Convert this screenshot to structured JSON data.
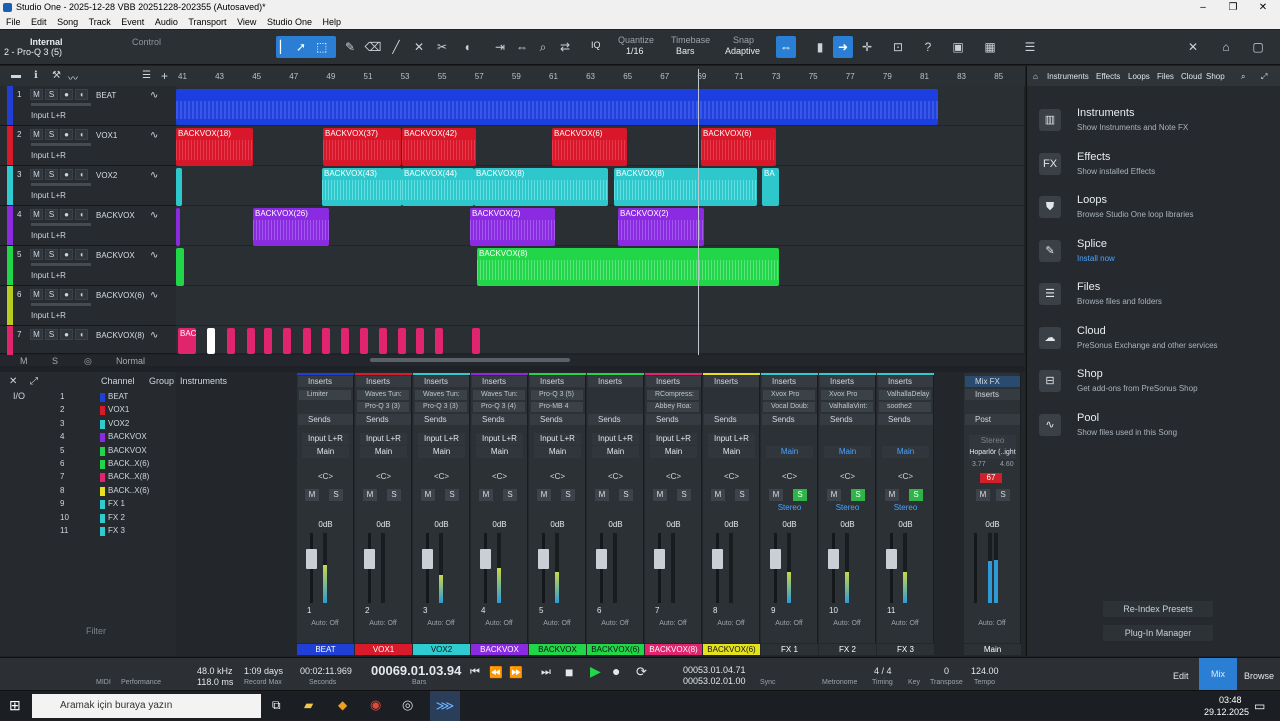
{
  "window": {
    "title": "Studio One - 2025-12-28 VBB 20251228-202355 (Autosaved)*"
  },
  "menu": [
    "File",
    "Edit",
    "Song",
    "Track",
    "Event",
    "Audio",
    "Transport",
    "View",
    "Studio One",
    "Help"
  ],
  "toolbar": {
    "sync_source": "Internal",
    "sync_alt": "Control",
    "focus": "2 - Pro-Q 3 (5)",
    "quantize_label": "Quantize",
    "quantize": "1/16",
    "timebase_label": "Timebase",
    "timebase": "Bars",
    "snap_label": "Snap",
    "snap": "Adaptive",
    "iq": "IQ"
  },
  "ruler": [
    "41",
    "43",
    "45",
    "47",
    "49",
    "51",
    "53",
    "55",
    "57",
    "59",
    "61",
    "63",
    "65",
    "67",
    "69",
    "71",
    "73",
    "75",
    "77",
    "79",
    "81",
    "83",
    "85"
  ],
  "tracks": [
    {
      "num": "1",
      "name": "BEAT",
      "input": "Input L+R",
      "color": "#1f3fd6"
    },
    {
      "num": "2",
      "name": "VOX1",
      "input": "Input L+R",
      "color": "#d91a2a"
    },
    {
      "num": "3",
      "name": "VOX2",
      "input": "Input L+R",
      "color": "#2ecbd0"
    },
    {
      "num": "4",
      "name": "BACKVOX",
      "input": "Input L+R",
      "color": "#8a2be2"
    },
    {
      "num": "5",
      "name": "BACKVOX",
      "input": "Input L+R",
      "color": "#22d64a"
    },
    {
      "num": "6",
      "name": "BACKVOX(6)",
      "input": "Input L+R",
      "color": "#b7cc1e"
    },
    {
      "num": "7",
      "name": "BACKVOX(8)",
      "input": "",
      "color": "#e0246e"
    }
  ],
  "clips": {
    "vox1": [
      "BACKVOX(18)",
      "BACKVOX(37)",
      "BACKVOX(42)",
      "BACKVOX(6)",
      "BACKVOX(6)"
    ],
    "vox2": [
      "BACKVOX(43)",
      "BACKVOX(44)",
      "BACKVOX(8)",
      "BACKVOX(8)",
      "BA"
    ],
    "backvox": [
      "BACKVOX(26)",
      "BACKVOX(2)",
      "BACKVOX(2)"
    ],
    "backvox5": [
      "BACKVOX(8)"
    ],
    "backvox8": [
      "BAC"
    ]
  },
  "timeline_footer": {
    "mode": "Normal"
  },
  "mixer_list": {
    "headers": [
      "Channel",
      "Group",
      "Instruments"
    ],
    "channels": [
      {
        "n": "1",
        "name": "BEAT"
      },
      {
        "n": "2",
        "name": "VOX1"
      },
      {
        "n": "3",
        "name": "VOX2"
      },
      {
        "n": "4",
        "name": "BACKVOX"
      },
      {
        "n": "5",
        "name": "BACKVOX"
      },
      {
        "n": "6",
        "name": "BACK..X(6)"
      },
      {
        "n": "7",
        "name": "BACK..X(8)"
      },
      {
        "n": "8",
        "name": "BACK..X(6)"
      },
      {
        "n": "9",
        "name": "FX 1"
      },
      {
        "n": "10",
        "name": "FX 2"
      },
      {
        "n": "11",
        "name": "FX 3"
      }
    ],
    "filter": "Filter",
    "io": "I/O"
  },
  "strips": [
    {
      "idx": "1",
      "label": "BEAT",
      "color": "#1f3fd6",
      "plugins": [
        "Limiter",
        ""
      ],
      "input": "Input L+R",
      "out": "Main",
      "db": "0dB",
      "meter": 0.55,
      "solo": false
    },
    {
      "idx": "2",
      "label": "VOX1",
      "color": "#d91a2a",
      "plugins": [
        "Waves Tun:",
        "Pro-Q 3 (3)"
      ],
      "input": "Input L+R",
      "out": "Main",
      "db": "0dB",
      "meter": 0.0,
      "solo": false
    },
    {
      "idx": "3",
      "label": "VOX2",
      "color": "#2ecbd0",
      "plugins": [
        "Waves Tun:",
        "Pro-Q 3 (3)"
      ],
      "input": "Input L+R",
      "out": "Main",
      "db": "0dB",
      "meter": 0.4,
      "solo": false
    },
    {
      "idx": "4",
      "label": "BACKVOX",
      "color": "#8a2be2",
      "plugins": [
        "Waves Tun:",
        "Pro-Q 3 (4)"
      ],
      "input": "Input L+R",
      "out": "Main",
      "db": "0dB",
      "meter": 0.5,
      "solo": false
    },
    {
      "idx": "5",
      "label": "BACKVOX",
      "color": "#22d64a",
      "plugins": [
        "Pro-Q 3 (5)",
        "Pro-MB 4"
      ],
      "input": "Input L+R",
      "out": "Main",
      "db": "0dB",
      "meter": 0.45,
      "solo": false
    },
    {
      "idx": "6",
      "label": "BACKVOX(6)",
      "color": "#22d64a",
      "plugins": [
        "",
        ""
      ],
      "input": "Input L+R",
      "out": "Main",
      "db": "0dB",
      "meter": 0.0,
      "solo": false
    },
    {
      "idx": "7",
      "label": "BACKVOX(8)",
      "color": "#e0246e",
      "plugins": [
        "RCompress:",
        "Abbey Roa:"
      ],
      "input": "Input L+R",
      "out": "Main",
      "db": "0dB",
      "meter": 0.0,
      "solo": false
    },
    {
      "idx": "8",
      "label": "BACKVOX(6)",
      "color": "#e4e21e",
      "plugins": [
        "",
        ""
      ],
      "input": "Input L+R",
      "out": "Main",
      "db": "0dB",
      "meter": 0.0,
      "solo": false
    },
    {
      "idx": "9",
      "label": "FX 1",
      "color": "#2ecbd0",
      "plugins": [
        "Xvox Pro",
        "Vocal Doub:"
      ],
      "input": "",
      "out": "Main",
      "db": "0dB",
      "meter": 0.45,
      "solo": true
    },
    {
      "idx": "10",
      "label": "FX 2",
      "color": "#2ecbd0",
      "plugins": [
        "Xvox Pro",
        "ValhallaVint:"
      ],
      "input": "",
      "out": "Main",
      "db": "0dB",
      "meter": 0.45,
      "solo": true
    },
    {
      "idx": "11",
      "label": "FX 3",
      "color": "#2ecbd0",
      "plugins": [
        "ValhallaDelay",
        "soothe2"
      ],
      "input": "",
      "out": "Main",
      "db": "0dB",
      "meter": 0.45,
      "solo": true
    }
  ],
  "strip_text": {
    "inserts": "Inserts",
    "sends": "Sends",
    "pan": "<C>",
    "auto": "Auto: Off",
    "stereo": "Stereo"
  },
  "main": {
    "label": "Main",
    "mixfx": "Mix FX",
    "post": "Post",
    "stereo": "Stereo",
    "out": "Hoparlör (..ight",
    "peak": "67",
    "l": "3.77",
    "r": "4.60",
    "db": "0dB"
  },
  "browser": {
    "tabs": [
      "Instruments",
      "Effects",
      "Loops",
      "Files",
      "Cloud",
      "Shop"
    ],
    "items": [
      {
        "icon": "piano-icon",
        "title": "Instruments",
        "desc": "Show Instruments and Note FX"
      },
      {
        "icon": "fx-icon",
        "title": "Effects",
        "desc": "Show installed Effects"
      },
      {
        "icon": "shield-icon",
        "title": "Loops",
        "desc": "Browse Studio One loop libraries"
      },
      {
        "icon": "splice-icon",
        "title": "Splice",
        "desc": "Install now"
      },
      {
        "icon": "list-icon",
        "title": "Files",
        "desc": "Browse files and folders"
      },
      {
        "icon": "cloud-icon",
        "title": "Cloud",
        "desc": "PreSonus Exchange and other services"
      },
      {
        "icon": "bag-icon",
        "title": "Shop",
        "desc": "Get add-ons from PreSonus Shop"
      },
      {
        "icon": "wave-icon",
        "title": "Pool",
        "desc": "Show files used in this Song"
      }
    ],
    "reindex": "Re-Index Presets",
    "plugin_manager": "Plug-In Manager"
  },
  "transport": {
    "midi": "MIDI",
    "performance": "Performance",
    "rate": "48.0 kHz",
    "latency": "118.0 ms",
    "rec_days": "1:09 days",
    "rec_label": "Record Max",
    "seconds": "00:02:11.969",
    "seconds_label": "Seconds",
    "bars": "00069.01.03.94",
    "bars_label": "Bars",
    "loop_start": "00053.01.04.71",
    "loop_end": "00053.02.01.00",
    "sync": "Sync",
    "metronome": "Metronome",
    "timing": "Timing",
    "sig": "4 / 4",
    "key": "Key",
    "transpose": "Transpose",
    "transpose_v": "0",
    "tempo": "124.00",
    "tempo_label": "Tempo",
    "edit": "Edit",
    "mix": "Mix",
    "browse": "Browse"
  },
  "taskbar": {
    "search": "Aramak için buraya yazın",
    "time": "03:48",
    "date": "29.12.2025"
  }
}
